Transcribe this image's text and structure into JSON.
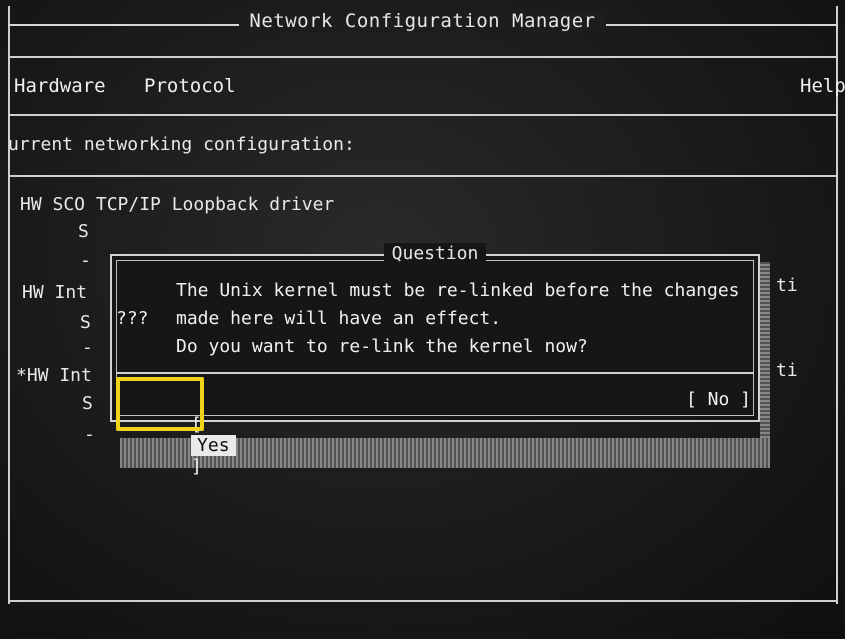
{
  "app": {
    "title": "Network Configuration Manager"
  },
  "menu": [
    {
      "label": "Hardware"
    },
    {
      "label": "Protocol"
    },
    {
      "label": "Help"
    }
  ],
  "heading": "urrent networking configuration:",
  "config_lines": {
    "line1": "HW SCO TCP/IP Loopback driver",
    "line1_sub": "S",
    "dash1": "-",
    "line2": "HW Int",
    "line2_sub": "S",
    "dash2": "-",
    "line3": "*HW Int",
    "line3_sub": "S",
    "dash3": "-",
    "right_ti_1": "ti",
    "right_ti_2": "ti"
  },
  "dialog": {
    "title": "Question",
    "icon_text": "???",
    "message": [
      "The Unix kernel must be re-linked before the changes",
      "made here will have an effect.",
      "Do you want to re-link the kernel now?"
    ],
    "yes_button": {
      "bracket_open": "[",
      "label": "Yes",
      "bracket_close": "]"
    },
    "no_button": "[ No ]"
  },
  "colors": {
    "background": "#1a1a1a",
    "text": "#e6e6e6",
    "highlight_border": "#f1d21a",
    "selected_button_bg": "#e9e9e9"
  }
}
